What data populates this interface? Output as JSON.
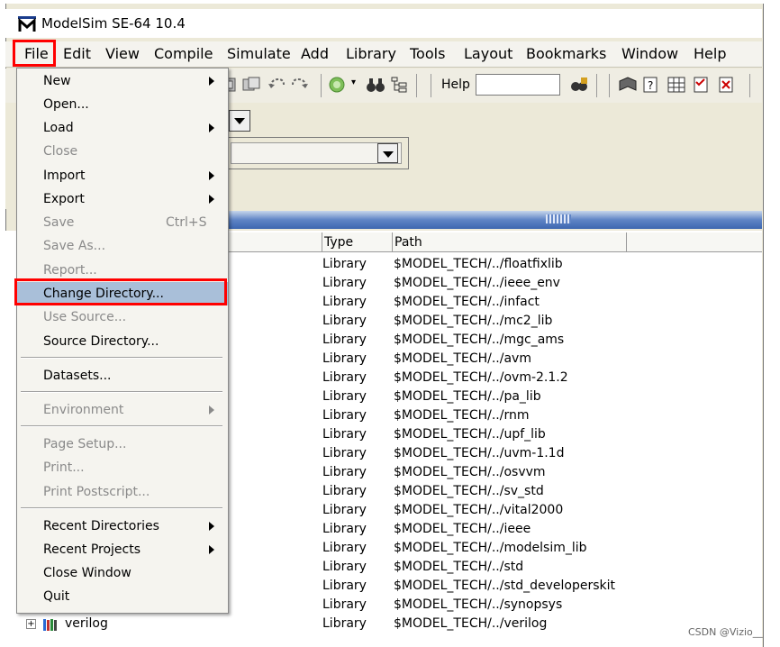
{
  "window": {
    "title": "ModelSim SE-64 10.4"
  },
  "menubar": {
    "items": [
      "File",
      "Edit",
      "View",
      "Compile",
      "Simulate",
      "Add",
      "Library",
      "Tools",
      "Layout",
      "Bookmarks",
      "Window",
      "Help"
    ],
    "active": "File"
  },
  "toolbar": {
    "help_label": "Help",
    "help_value": ""
  },
  "table": {
    "columns": {
      "type": "Type",
      "path": "Path"
    },
    "rows": [
      {
        "name": "",
        "type": "Library",
        "path": "$MODEL_TECH/../floatfixlib"
      },
      {
        "name": "",
        "type": "Library",
        "path": "$MODEL_TECH/../ieee_env"
      },
      {
        "name": "",
        "type": "Library",
        "path": "$MODEL_TECH/../infact"
      },
      {
        "name": "",
        "type": "Library",
        "path": "$MODEL_TECH/../mc2_lib"
      },
      {
        "name": "",
        "type": "Library",
        "path": "$MODEL_TECH/../mgc_ams"
      },
      {
        "name": "",
        "type": "Library",
        "path": "$MODEL_TECH/../avm"
      },
      {
        "name": "",
        "type": "Library",
        "path": "$MODEL_TECH/../ovm-2.1.2"
      },
      {
        "name": "",
        "type": "Library",
        "path": "$MODEL_TECH/../pa_lib"
      },
      {
        "name": "",
        "type": "Library",
        "path": "$MODEL_TECH/../rnm"
      },
      {
        "name": "",
        "type": "Library",
        "path": "$MODEL_TECH/../upf_lib"
      },
      {
        "name": "",
        "type": "Library",
        "path": "$MODEL_TECH/../uvm-1.1d"
      },
      {
        "name": "",
        "type": "Library",
        "path": "$MODEL_TECH/../osvvm"
      },
      {
        "name": "",
        "type": "Library",
        "path": "$MODEL_TECH/../sv_std"
      },
      {
        "name": "",
        "type": "Library",
        "path": "$MODEL_TECH/../vital2000"
      },
      {
        "name": "",
        "type": "Library",
        "path": "$MODEL_TECH/../ieee"
      },
      {
        "name": "",
        "type": "Library",
        "path": "$MODEL_TECH/../modelsim_lib"
      },
      {
        "name": "",
        "type": "Library",
        "path": "$MODEL_TECH/../std"
      },
      {
        "name": "",
        "type": "Library",
        "path": "$MODEL_TECH/../std_developerskit"
      },
      {
        "name": "",
        "type": "Library",
        "path": "$MODEL_TECH/../synopsys"
      },
      {
        "name": "verilog",
        "type": "Library",
        "path": "$MODEL_TECH/../verilog"
      }
    ]
  },
  "file_menu": {
    "items": [
      {
        "label": "New",
        "submenu": true,
        "disabled": false
      },
      {
        "label": "Open...",
        "submenu": false,
        "disabled": false
      },
      {
        "label": "Load",
        "submenu": true,
        "disabled": false
      },
      {
        "label": "Close",
        "submenu": false,
        "disabled": true
      },
      {
        "label": "Import",
        "submenu": true,
        "disabled": false
      },
      {
        "label": "Export",
        "submenu": true,
        "disabled": false
      },
      {
        "label": "Save",
        "shortcut": "Ctrl+S",
        "submenu": false,
        "disabled": true
      },
      {
        "label": "Save As...",
        "submenu": false,
        "disabled": true
      },
      {
        "label": "Report...",
        "submenu": false,
        "disabled": true
      },
      {
        "label": "Change Directory...",
        "submenu": false,
        "disabled": false,
        "selected": true
      },
      {
        "label": "Use Source...",
        "submenu": false,
        "disabled": true
      },
      {
        "label": "Source Directory...",
        "submenu": false,
        "disabled": false
      },
      {
        "label": "Datasets...",
        "submenu": false,
        "disabled": false
      },
      {
        "label": "Environment",
        "submenu": true,
        "disabled": true
      },
      {
        "label": "Page Setup...",
        "submenu": false,
        "disabled": true
      },
      {
        "label": "Print...",
        "submenu": false,
        "disabled": true
      },
      {
        "label": "Print Postscript...",
        "submenu": false,
        "disabled": true
      },
      {
        "label": "Recent Directories",
        "submenu": true,
        "disabled": false
      },
      {
        "label": "Recent Projects",
        "submenu": true,
        "disabled": false
      },
      {
        "label": "Close Window",
        "submenu": false,
        "disabled": false
      },
      {
        "label": "Quit",
        "submenu": false,
        "disabled": false
      }
    ]
  },
  "watermark": "CSDN @Vizio__",
  "colors": {
    "highlight_box": "#ff0000",
    "menu_selection": "#a9bfd9",
    "divider_bar": "#5f84c5"
  }
}
